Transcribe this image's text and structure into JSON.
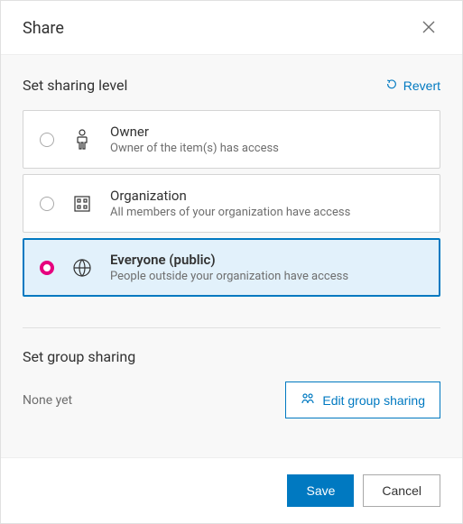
{
  "header": {
    "title": "Share"
  },
  "sharing_level": {
    "title": "Set sharing level",
    "revert_label": "Revert",
    "options": [
      {
        "title": "Owner",
        "desc": "Owner of the item(s) has access",
        "selected": false,
        "icon": "person-icon"
      },
      {
        "title": "Organization",
        "desc": "All members of your organization have access",
        "selected": false,
        "icon": "organization-icon"
      },
      {
        "title": "Everyone (public)",
        "desc": "People outside your organization have access",
        "selected": true,
        "icon": "globe-icon"
      }
    ]
  },
  "group_sharing": {
    "title": "Set group sharing",
    "none_label": "None yet",
    "edit_label": "Edit group sharing"
  },
  "footer": {
    "save_label": "Save",
    "cancel_label": "Cancel"
  }
}
